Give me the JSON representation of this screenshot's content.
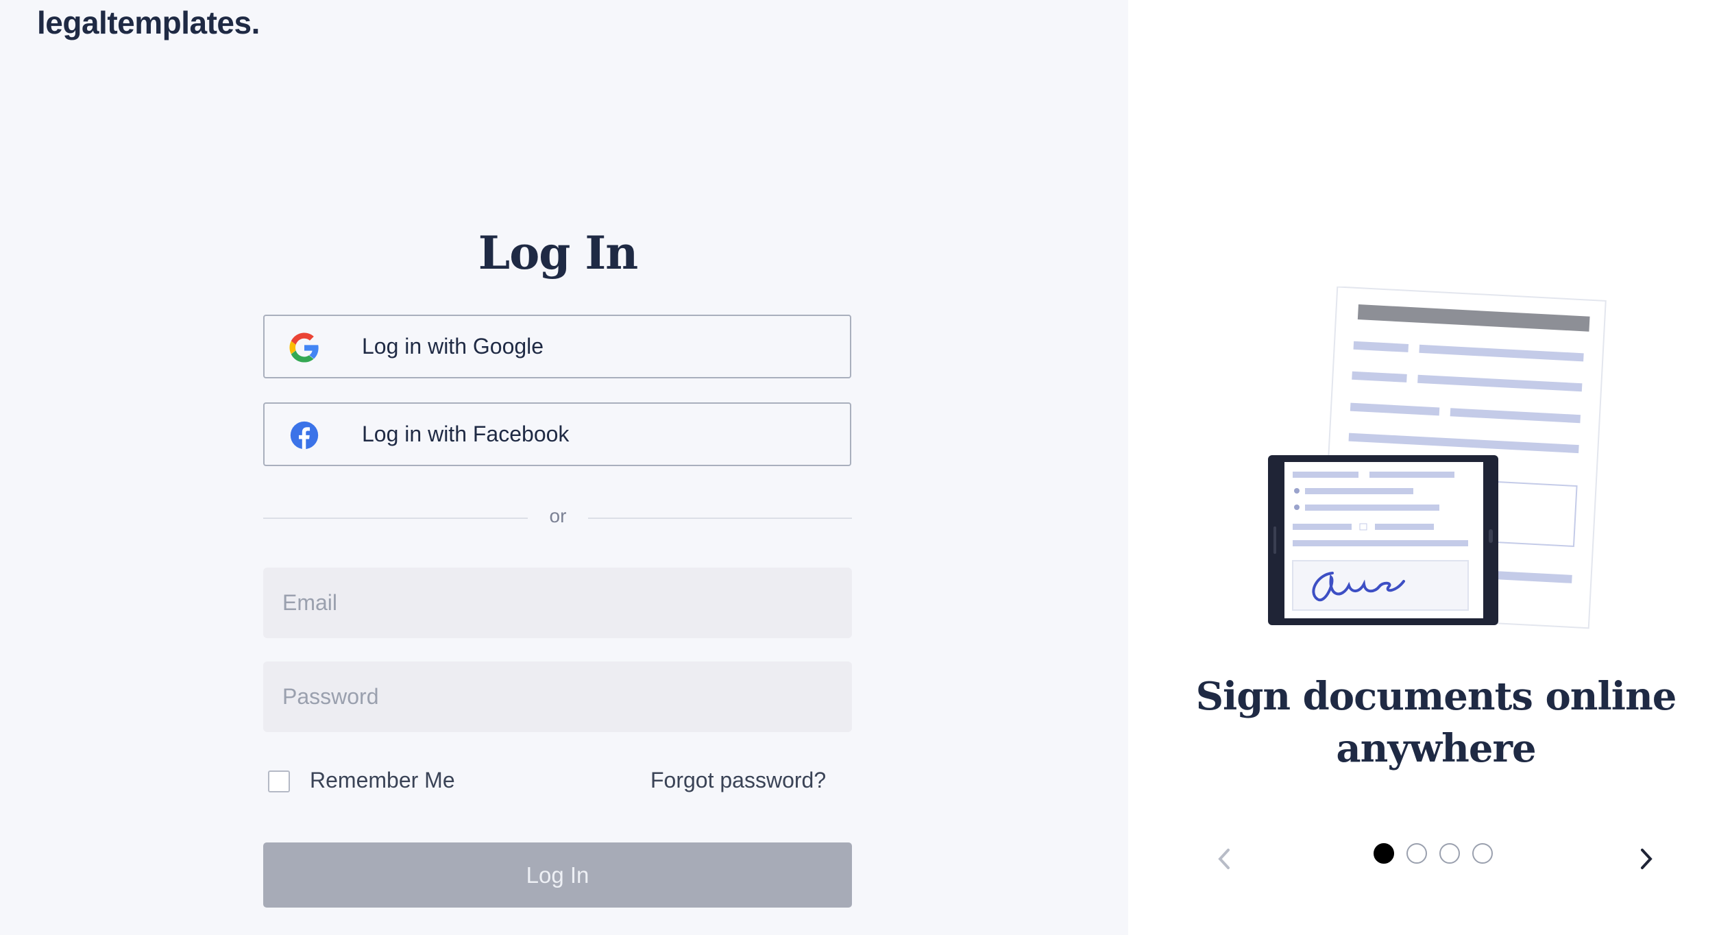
{
  "brand": {
    "logo_text": "legaltemplates."
  },
  "login": {
    "title": "Log In",
    "google_label": "Log in with Google",
    "facebook_label": "Log in with Facebook",
    "divider_text": "or",
    "email_placeholder": "Email",
    "password_placeholder": "Password",
    "remember_label": "Remember Me",
    "forgot_label": "Forgot password?",
    "submit_label": "Log In"
  },
  "carousel": {
    "slide_title": "Sign documents online anywhere",
    "total_slides": 4,
    "active_index": 0,
    "icons": {
      "prev": "chevron-left-icon",
      "next": "chevron-right-icon"
    }
  },
  "colors": {
    "left_bg": "#f6f7fb",
    "right_bg": "#ffffff",
    "text_dark": "#1f2a44",
    "submit_disabled": "#a7abb7",
    "input_bg": "#ededf2",
    "illustration_accent": "#c4cbe8",
    "signature_ink": "#3d4fc4"
  }
}
